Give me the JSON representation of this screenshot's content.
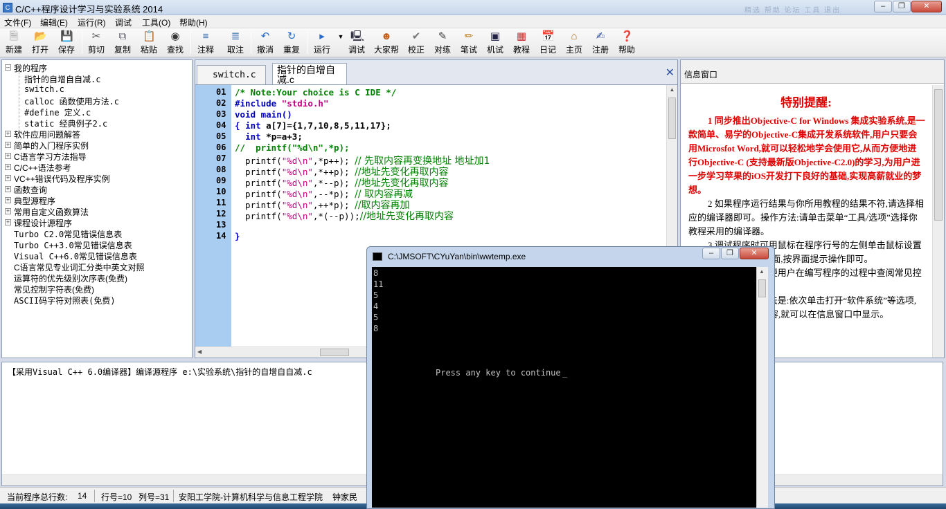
{
  "app": {
    "title": "C/C++程序设计学习与实验系统 2014",
    "ghost_text": "精选  帮助  论坛  工具  退出"
  },
  "menu": [
    "文件(F)",
    "编辑(E)",
    "运行(R)",
    "调试",
    "工具(O)",
    "帮助(H)"
  ],
  "toolbar": [
    {
      "label": "新建",
      "icon": "new-file-icon"
    },
    {
      "label": "打开",
      "icon": "open-folder-icon"
    },
    {
      "label": "保存",
      "icon": "save-icon"
    },
    {
      "label": "剪切",
      "icon": "scissors-icon"
    },
    {
      "label": "复制",
      "icon": "copy-icon"
    },
    {
      "label": "粘贴",
      "icon": "paste-icon"
    },
    {
      "label": "查找",
      "icon": "binoculars-icon"
    },
    {
      "label": "注释",
      "icon": "comment-icon"
    },
    {
      "label": "取注",
      "icon": "uncomment-icon"
    },
    {
      "label": "撤消",
      "icon": "undo-icon"
    },
    {
      "label": "重复",
      "icon": "redo-icon"
    },
    {
      "label": "运行",
      "icon": "run-icon"
    },
    {
      "label": "调试",
      "icon": "debug-icon"
    },
    {
      "label": "大家帮",
      "icon": "people-icon"
    },
    {
      "label": "校正",
      "icon": "check-icon"
    },
    {
      "label": "对练",
      "icon": "practice-icon"
    },
    {
      "label": "笔试",
      "icon": "pencil-icon"
    },
    {
      "label": "机试",
      "icon": "machine-test-icon"
    },
    {
      "label": "教程",
      "icon": "books-icon"
    },
    {
      "label": "日记",
      "icon": "diary-icon"
    },
    {
      "label": "主页",
      "icon": "home-icon"
    },
    {
      "label": "注册",
      "icon": "register-icon"
    },
    {
      "label": "帮助",
      "icon": "help-icon"
    }
  ],
  "tree": {
    "root": "我的程序",
    "children": [
      "指针的自增自自减.c",
      "switch.c",
      "calloc 函数使用方法.c",
      "#define 定义.c",
      "static 经典例子2.c"
    ],
    "groups": [
      "软件应用问题解答",
      "简单的入门程序实例",
      "C语言学习方法指导",
      "C/C++语法参考",
      "VC++错误代码及程序实例",
      "函数查询",
      "典型源程序",
      "常用自定义函数算法",
      "课程设计源程序"
    ],
    "leaves": [
      "Turbo C2.0常见错误信息表",
      "Turbo C++3.0常见错误信息表",
      "Visual C++6.0常见错误信息表",
      "C语言常见专业词汇分类中英文对照",
      "运算符的优先级别次序表(免费)",
      "常见控制字符表(免费)",
      "ASCII码字符对照表(免费)"
    ]
  },
  "tabs": [
    "switch.c",
    "指针的自增自减.c"
  ],
  "code": {
    "line_numbers": [
      "01",
      "02",
      "03",
      "04",
      "05",
      "06",
      "07",
      "08",
      "09",
      "10",
      "11",
      "12",
      "13",
      "14"
    ],
    "l01": "/* Note:Your choice is C IDE */",
    "l02_a": "#include ",
    "l02_b": "\"stdio.h\"",
    "l03": "void main()",
    "l04_a": "{ ",
    "l04_b": "int",
    "l04_c": " a[7]={1,7,10,8,5,11,17};",
    "l05_a": "  ",
    "l05_b": "int",
    "l05_c": " *p=a+3;",
    "l06": "//  printf(\"%d\\n\",*p);",
    "l07_a": "  printf(",
    "l07_b": "\"%d\\n\"",
    "l07_c": ",*p++); ",
    "l07_d": "// 先取内容再变换地址 地址加1",
    "l08_a": "  printf(",
    "l08_b": "\"%d\\n\"",
    "l08_c": ",*++p); ",
    "l08_d": "//地址先变化再取内容",
    "l09_a": "  printf(",
    "l09_b": "\"%d\\n\"",
    "l09_c": ",*--p); ",
    "l09_d": "//地址先变化再取内容",
    "l10_a": "  printf(",
    "l10_b": "\"%d\\n\"",
    "l10_c": ",--*p); ",
    "l10_d": "// 取内容再减",
    "l11_a": "  printf(",
    "l11_b": "\"%d\\n\"",
    "l11_c": ",++*p); ",
    "l11_d": "//取内容再加",
    "l12_a": "  printf(",
    "l12_b": "\"%d\\n\"",
    "l12_c": ",*(--p));",
    "l12_d": "//地址先变化再取内容",
    "l14": "}"
  },
  "info": {
    "header": "信息窗口",
    "heading": "特别提醒:",
    "p1": "1 同步推出Objective-C for Windows 集成实验系统,是一款简单、易学的Objective-C集成开发系统软件,用户只要会用Microsfot Word,就可以轻松地学会使用它,从而方便地进行Objective-C (支持最新版Objective-C2.0)的学习,为用户进一步学习苹果的iOS开发打下良好的基础,实现高薪就业的梦想。",
    "p2": "2 如果程序运行结果与你所用教程的结果不符,请选择相应的编译器即可。操作方法:请单击菜单“工具/选项”选择你教程采用的编译器。",
    "p3": "3 调试程序时可用鼠标在程序行号的左侧单击鼠标设置断点,就会出现调试界面,按界面提示操作即可。",
    "p4": "4 本软件为了方便用户在编写程序的过程中查阅常见控制字符、ASCII等。",
    "p5": "5 查看实例的方法是:依次单击打开“软件系统”等选项,然后双击要打开的内容,就可以在信息窗口中显示。"
  },
  "log": {
    "line": "【采用Visual C++ 6.0编译器】编译源程序 e:\\实验系统\\指针的自增自自减.c"
  },
  "status": {
    "total_lines_label": "当前程序总行数:",
    "total_lines_value": "14",
    "row": "行号=10",
    "col": "列号=31",
    "org": "安阳工学院-计算机科学与信息工程学院",
    "author": "钟家民"
  },
  "console": {
    "title": "C:\\JMSOFT\\CYuYan\\bin\\wwtemp.exe",
    "output": [
      "8",
      "11",
      "5",
      "4",
      "5",
      "8"
    ],
    "prompt": "Press any key to continue"
  }
}
